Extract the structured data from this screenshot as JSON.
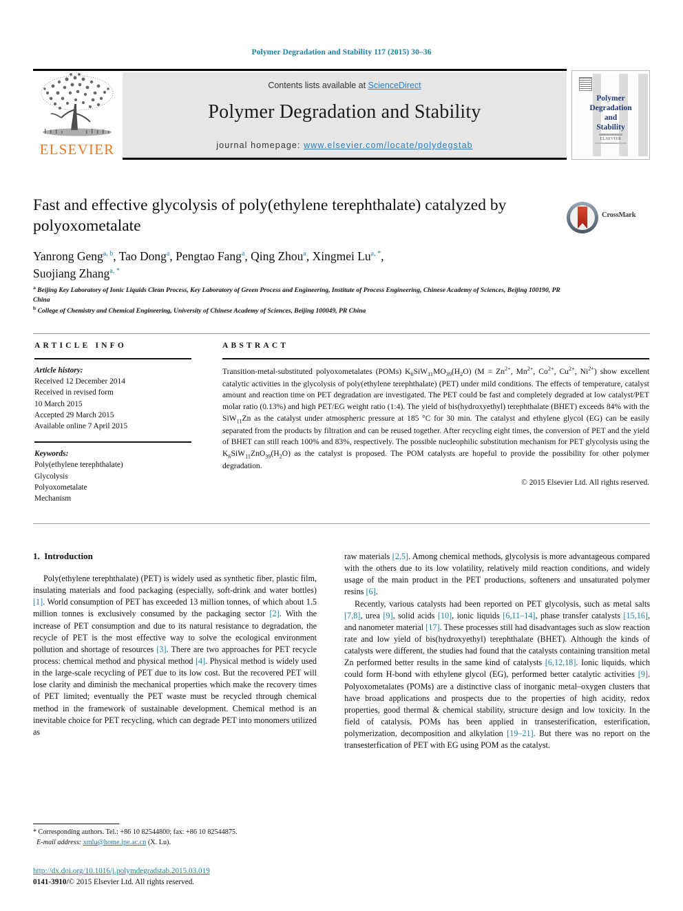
{
  "running_head": "Polymer Degradation and Stability 117 (2015) 30–36",
  "masthead": {
    "contents_prefix": "Contents lists available at ",
    "contents_link": "ScienceDirect",
    "journal_title": "Polymer Degradation and Stability",
    "homepage_label": "journal homepage: ",
    "homepage_url": "www.elsevier.com/locate/polydegstab",
    "publisher_logo_text": "ELSEVIER",
    "cover_title_lines": [
      "Polymer",
      "Degradation",
      "and",
      "Stability"
    ],
    "cover_footer_text": "ELSEVIER"
  },
  "article": {
    "title": "Fast and effective glycolysis of poly(ethylene terephthalate) catalyzed by polyoxometalate",
    "crossmark_label": "CrossMark",
    "authors_line_1": "Yanrong Geng a, b, Tao Dong a, Pengtao Fang a, Qing Zhou a, Xingmei Lu a, *,",
    "authors_line_2": "Suojiang Zhang a, *",
    "authors": [
      {
        "name": "Yanrong Geng",
        "marks": "a, b"
      },
      {
        "name": "Tao Dong",
        "marks": "a"
      },
      {
        "name": "Pengtao Fang",
        "marks": "a"
      },
      {
        "name": "Qing Zhou",
        "marks": "a"
      },
      {
        "name": "Xingmei Lu",
        "marks": "a, *"
      },
      {
        "name": "Suojiang Zhang",
        "marks": "a, *"
      }
    ],
    "affiliations": [
      {
        "mark": "a",
        "text": "Beijing Key Laboratory of Ionic Liquids Clean Process, Key Laboratory of Green Process and Engineering, Institute of Process Engineering, Chinese Academy of Sciences, Beijing 100190, PR China"
      },
      {
        "mark": "b",
        "text": "College of Chemistry and Chemical Engineering, University of Chinese Academy of Sciences, Beijing 100049, PR China"
      }
    ]
  },
  "article_info": {
    "heading": "ARTICLE INFO",
    "history_label": "Article history:",
    "history": [
      "Received 12 December 2014",
      "Received in revised form",
      "10 March 2015",
      "Accepted 29 March 2015",
      "Available online 7 April 2015"
    ],
    "keywords_label": "Keywords:",
    "keywords": [
      "Poly(ethylene terephthalate)",
      "Glycolysis",
      "Polyoxometalate",
      "Mechanism"
    ]
  },
  "abstract": {
    "heading": "ABSTRACT",
    "paragraph_plain": "Transition-metal-substituted polyoxometalates (POMs) K6SiW11MO39(H2O) (M = Zn2+, Mn2+, Co2+, Cu2+, Ni2+) show excellent catalytic activities in the glycolysis of poly(ethylene terephthalate) (PET) under mild conditions. The effects of temperature, catalyst amount and reaction time on PET degradation are investigated. The PET could be fast and completely degraded at low catalyst/PET molar ratio (0.13%) and high PET/EG weight ratio (1:4). The yield of bis(hydroxyethyl) terephthalate (BHET) exceeds 84% with the SiW11Zn as the catalyst under atmospheric pressure at 185 °C for 30 min. The catalyst and ethylene glycol (EG) can be easily separated from the products by filtration and can be reused together. After recycling eight times, the conversion of PET and the yield of BHET can still reach 100% and 83%, respectively. The possible nucleophilic substitution mechanism for PET glycolysis using the K6SiW11ZnO39(H2O) as the catalyst is proposed. The POM catalysts are hopeful to provide the possibility for other polymer degradation.",
    "copyright": "© 2015 Elsevier Ltd. All rights reserved."
  },
  "body": {
    "section_number": "1.",
    "section_title": "Introduction",
    "left_paragraph_1": "Poly(ethylene terephthalate) (PET) is widely used as synthetic fiber, plastic film, insulating materials and food packaging (especially, soft-drink and water bottles) [1]. World consumption of PET has exceeded 13 million tonnes, of which about 1.5 million tonnes is exclusively consumed by the packaging sector [2]. With the increase of PET consumption and due to its natural resistance to degradation, the recycle of PET is the most effective way to solve the ecological environment pollution and shortage of resources [3]. There are two approaches for PET recycle process: chemical method and physical method [4]. Physical method is widely used in the large-scale recycling of PET due to its low cost. But the recovered PET will lose clarity and diminish the mechanical properties which make the recovery times of PET limited; eventually the PET waste must be recycled through chemical method in the framework of sustainable development. Chemical method is an inevitable choice for PET recycling, which can degrade PET into monomers utilized as",
    "right_paragraph_1": "raw materials [2,5]. Among chemical methods, glycolysis is more advantageous compared with the others due to its low volatility, relatively mild reaction conditions, and widely usage of the main product in the PET productions, softeners and unsaturated polymer resins [6].",
    "right_paragraph_2": "Recently, various catalysts had been reported on PET glycolysis, such as metal salts [7,8], urea [9], solid acids [10], ionic liquids [6,11–14], phase transfer catalysts [15,16], and nanometer material [17]. These processes still had disadvantages such as slow reaction rate and low yield of bis(hydroxyethyl) terephthalate (BHET). Although the kinds of catalysts were different, the studies had found that the catalysts containing transition metal Zn performed better results in the same kind of catalysts [6,12,18]. Ionic liquids, which could form H-bond with ethylene glycol (EG), performed better catalytic activities [9]. Polyoxometalates (POMs) are a distinctive class of inorganic metal—oxygen clusters that have broad applications and prospects due to the properties of high acidity, redox properties, good thermal & chemical stability, structure design and low toxicity. In the field of catalysis, POMs has been applied in transesterification, esterification, polymerization, decomposition and alkylation [19–21]. But there was no report on the transesterfication of PET with EG using POM as the catalyst."
  },
  "footnote": {
    "star": "*",
    "corresponding": "Corresponding authors. Tel.: +86 10 82544800; fax: +86 10 82544875.",
    "email_label": "E-mail address:",
    "email": "xmlu@home.ipe.ac.cn",
    "email_owner": "(X. Lu)."
  },
  "footer": {
    "doi": "http://dx.doi.org/10.1016/j.polymdegradstab.2015.03.019",
    "issn_prefix": "0141-3910/",
    "issn_rest": "© 2015 Elsevier Ltd. All rights reserved."
  },
  "colors": {
    "link": "#1b7fa8",
    "sd_link": "#2a7fbf",
    "elsevier_orange": "#e87722",
    "cover_blue": "#1f3a78",
    "band_gray": "#e6e6e6"
  }
}
